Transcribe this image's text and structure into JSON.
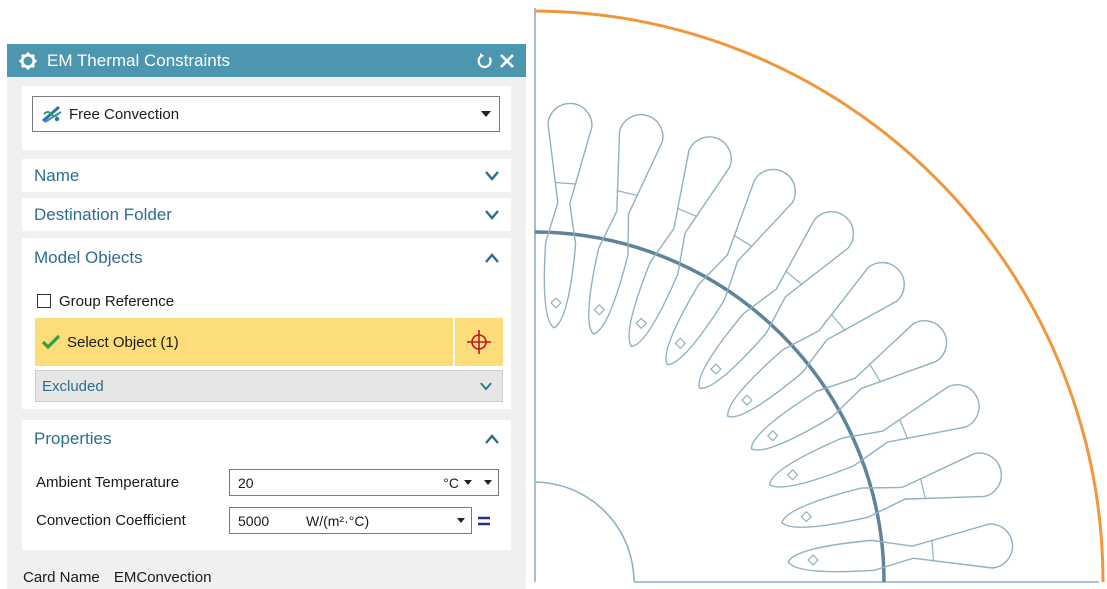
{
  "dialog": {
    "title": "EM Thermal Constraints",
    "type_dropdown": {
      "value": "Free Convection"
    },
    "sections": {
      "name": "Name",
      "destination": "Destination Folder",
      "model_objects": "Model Objects",
      "properties": "Properties"
    },
    "model_objects": {
      "group_reference": "Group Reference",
      "select_object": "Select Object (1)",
      "excluded": "Excluded"
    },
    "properties": {
      "ambient_label": "Ambient Temperature",
      "ambient_value": "20",
      "ambient_unit": "°C",
      "coeff_label": "Convection Coefficient",
      "coeff_value": "5000",
      "coeff_unit": "W/(m²·°C)"
    },
    "card": {
      "label": "Card Name",
      "value": "EMConvection"
    }
  },
  "colors": {
    "title_bar": "#4c96b0",
    "section_text": "#2d6d8f",
    "selection_highlight": "#fddc7a",
    "outline_highlight": "#f0963c",
    "ring_line": "#5e8499",
    "geometry_line": "#8fb0c2"
  },
  "icons": [
    "gear-icon",
    "reset-icon",
    "close-icon",
    "convection-icon",
    "dropdown-arrow-icon",
    "chevron-down-icon",
    "chevron-up-icon",
    "checkmark-icon",
    "crosshair-icon",
    "equals-icon"
  ]
}
